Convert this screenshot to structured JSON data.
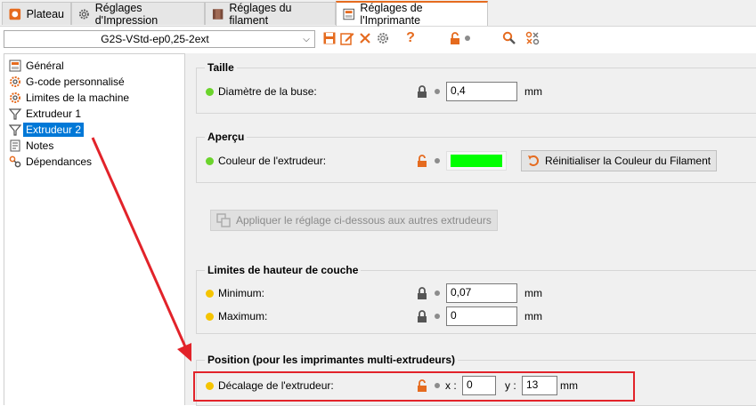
{
  "tabs": [
    {
      "label": "Plateau"
    },
    {
      "label": "Réglages d'Impression"
    },
    {
      "label": "Réglages du filament"
    },
    {
      "label": "Réglages de l'Imprimante"
    }
  ],
  "toolbar": {
    "preset_value": "G2S-VStd-ep0,25-2ext",
    "help_glyph": "?"
  },
  "tree": [
    {
      "label": "Général",
      "icon": "printer-icon"
    },
    {
      "label": "G-code personnalisé",
      "icon": "cog-icon"
    },
    {
      "label": "Limites de la machine",
      "icon": "cog-icon"
    },
    {
      "label": "Extrudeur 1",
      "icon": "funnel-icon"
    },
    {
      "label": "Extrudeur 2",
      "icon": "funnel-icon",
      "selected": true
    },
    {
      "label": "Notes",
      "icon": "notes-icon"
    },
    {
      "label": "Dépendances",
      "icon": "dependencies-icon"
    }
  ],
  "groups": {
    "taille": {
      "title": "Taille",
      "nozzle_label": "Diamètre de la buse:",
      "nozzle_value": "0,4",
      "nozzle_unit": "mm"
    },
    "apercu": {
      "title": "Aperçu",
      "color_label": "Couleur de l'extrudeur:",
      "color_value": "#00ff00",
      "reset_label": "Réinitialiser la Couleur du Filament"
    },
    "apply_label": "Appliquer le réglage ci-dessous aux autres extrudeurs",
    "layer": {
      "title": "Limites de hauteur de couche",
      "min_label": "Minimum:",
      "min_value": "0,07",
      "max_label": "Maximum:",
      "max_value": "0",
      "unit": "mm"
    },
    "position": {
      "title": "Position (pour les imprimantes multi-extrudeurs)",
      "offset_label": "Décalage de l'extrudeur:",
      "x_label": "x :",
      "x_value": "0",
      "y_label": "y :",
      "y_value": "13",
      "unit": "mm"
    }
  },
  "colors": {
    "accent": "#e56b1f",
    "selection": "#0078d7",
    "highlight": "#e2232a",
    "ok_dot": "#6bd42c",
    "advanced_dot": "#f5c400"
  }
}
